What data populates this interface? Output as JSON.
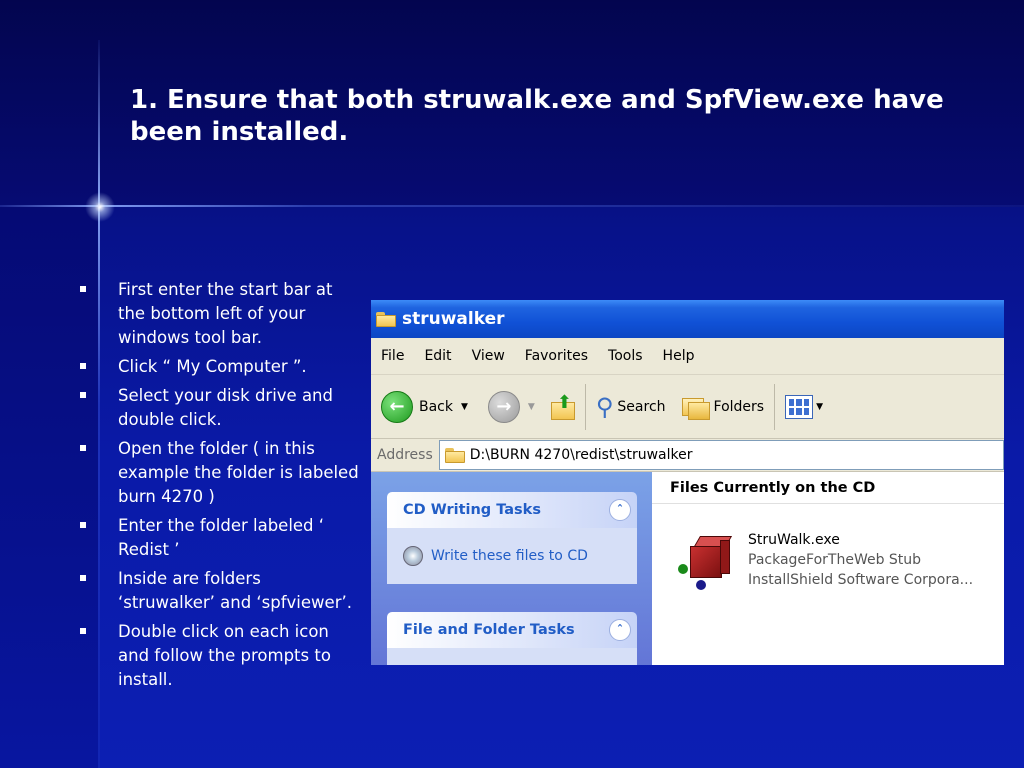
{
  "slide": {
    "title": "1. Ensure that both struwalk.exe and SpfView.exe have been installed.",
    "bullets": [
      "First enter the start bar at the bottom left of your windows tool bar.",
      "Click “ My Computer ”.",
      "Select your disk drive and double click.",
      "Open the folder ( in this example the folder is labeled burn 4270 )",
      "Enter the folder labeled ‘ Redist ’",
      "Inside are folders ‘struwalker’ and ‘spfviewer’.",
      "Double click on each icon and follow the prompts to install."
    ]
  },
  "explorer": {
    "window_title": "struwalker",
    "menu": [
      "File",
      "Edit",
      "View",
      "Favorites",
      "Tools",
      "Help"
    ],
    "toolbar": {
      "back_label": "Back",
      "search_label": "Search",
      "folders_label": "Folders"
    },
    "address": {
      "label": "Address",
      "value": "D:\\BURN 4270\\redist\\struwalker"
    },
    "tasks": {
      "cd_writing_title": "CD Writing Tasks",
      "cd_writing_item": "Write these files to CD",
      "file_folder_title": "File and Folder Tasks"
    },
    "files": {
      "header": "Files Currently on the CD",
      "item": {
        "name": "StruWalk.exe",
        "description": "PackageForTheWeb Stub",
        "company": "InstallShield Software Corpora..."
      }
    }
  },
  "colors": {
    "background": "#0a1aa8",
    "title_bar": "#1051d6",
    "task_link": "#215dc6"
  }
}
